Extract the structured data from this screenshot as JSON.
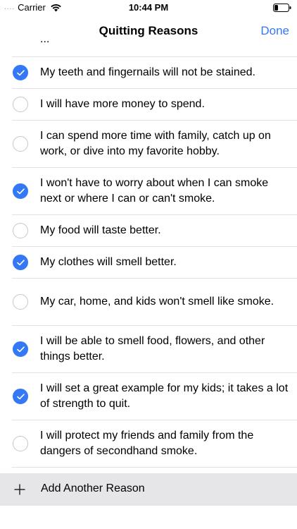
{
  "status_bar": {
    "carrier": "Carrier",
    "time": "10:44 PM",
    "signal_dots": "....",
    "icons": [
      "wifi-icon",
      "battery-icon"
    ]
  },
  "nav": {
    "title": "Quitting Reasons",
    "done_label": "Done"
  },
  "peek_text": "...",
  "reasons": [
    {
      "text": "My teeth and fingernails will not be stained.",
      "checked": true
    },
    {
      "text": "I will have more money to spend.",
      "checked": false
    },
    {
      "text": "I can spend more time with family, catch up on work, or dive into my favorite hobby.",
      "checked": false
    },
    {
      "text": "I won't have to worry about when I can smoke next or where I can or can't smoke.",
      "checked": true
    },
    {
      "text": "My food will taste better.",
      "checked": false
    },
    {
      "text": "My clothes will smell better.",
      "checked": true
    },
    {
      "text": "My car, home, and kids won't smell like smoke.",
      "checked": false
    },
    {
      "text": "I will be able to smell food, flowers, and other things better.",
      "checked": true
    },
    {
      "text": "I will set a great example for my kids; it takes a lot of strength to quit.",
      "checked": true
    },
    {
      "text": "I will protect my friends and family from the dangers of secondhand smoke.",
      "checked": false
    }
  ],
  "add_reason": {
    "label": "Add Another Reason",
    "icon": "plus-icon"
  },
  "colors": {
    "accent": "#3478f6",
    "separator": "#e1e1e6",
    "add_bar_bg": "#e6e6e8"
  }
}
